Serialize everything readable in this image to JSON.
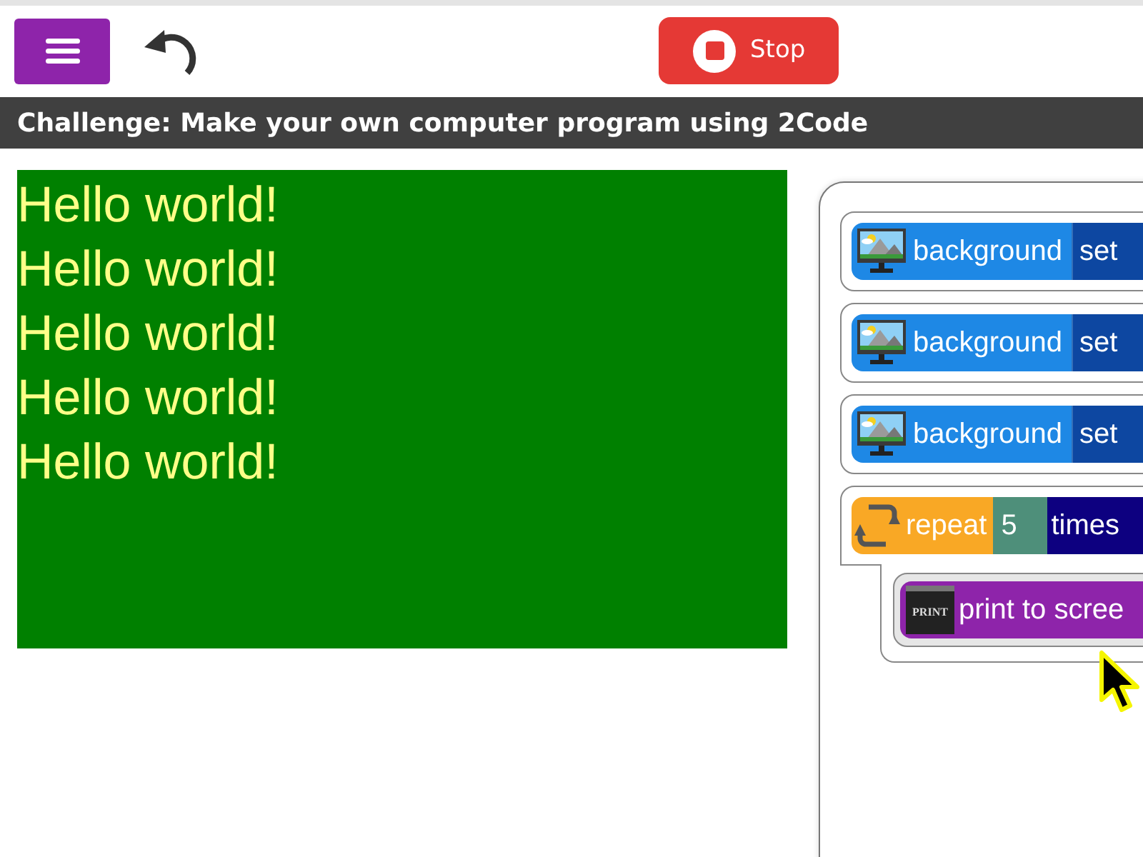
{
  "toolbar": {
    "stop_button": "Stop"
  },
  "challenge_bar": {
    "title": "Challenge: Make your own computer program using 2Code"
  },
  "output": {
    "lines": [
      "Hello world!",
      "Hello world!",
      "Hello world!",
      "Hello world!",
      "Hello world!"
    ]
  },
  "code_blocks": [
    {
      "kind": "background",
      "label": "background",
      "action": "set"
    },
    {
      "kind": "background",
      "label": "background",
      "action": "set"
    },
    {
      "kind": "background",
      "label": "background",
      "action": "set"
    },
    {
      "kind": "repeat",
      "label": "repeat",
      "count": "5",
      "suffix": "times",
      "children": [
        {
          "kind": "print",
          "icon_text": "PRINT",
          "label": "print to scree"
        }
      ]
    }
  ]
}
